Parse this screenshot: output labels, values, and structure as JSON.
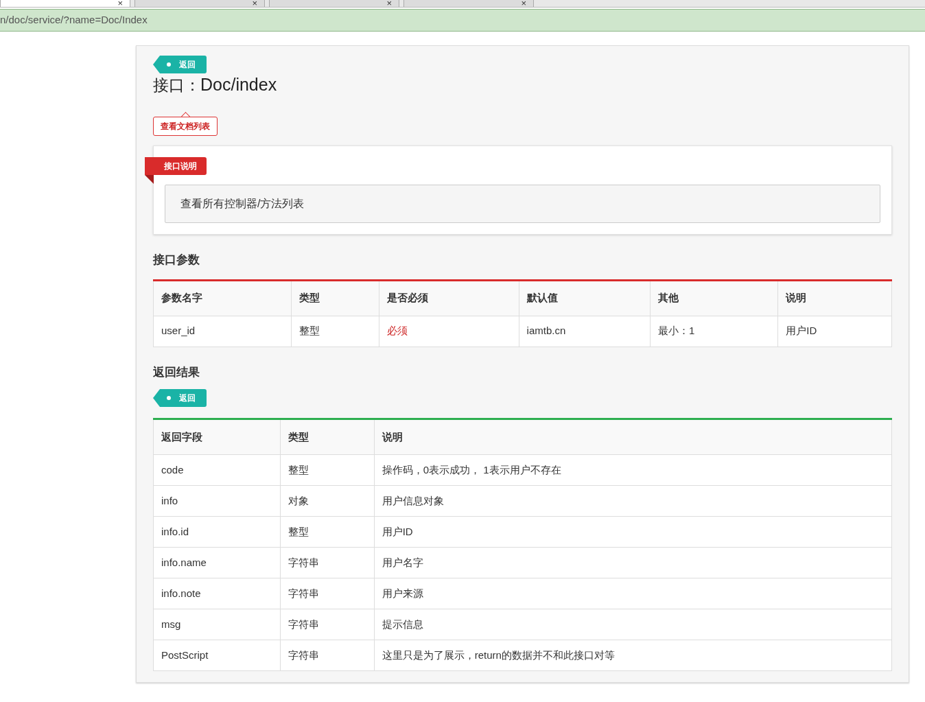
{
  "browser": {
    "tabs": [
      {
        "close": "×",
        "selected": true
      },
      {
        "close": "×",
        "selected": false
      },
      {
        "close": "×",
        "selected": false
      },
      {
        "close": "×",
        "selected": false
      }
    ],
    "address": "n/doc/service/?name=Doc/Index"
  },
  "back_tag": "返回",
  "title_prefix": "接口：",
  "title": "Doc/index",
  "doc_list_button": "查看文档列表",
  "description": {
    "ribbon": "接口说明",
    "text": "查看所有控制器/方法列表"
  },
  "params": {
    "heading": "接口参数",
    "columns": [
      "参数名字",
      "类型",
      "是否必须",
      "默认值",
      "其他",
      "说明"
    ],
    "rows": [
      {
        "cells": [
          "user_id",
          "整型",
          "必须",
          "iamtb.cn",
          "最小：1",
          "用户ID"
        ],
        "required": true
      }
    ]
  },
  "results": {
    "heading": "返回结果",
    "tag": "返回",
    "columns": [
      "返回字段",
      "类型",
      "说明"
    ],
    "rows": [
      [
        "code",
        "整型",
        "操作码，0表示成功， 1表示用户不存在"
      ],
      [
        "info",
        "对象",
        "用户信息对象"
      ],
      [
        "info.id",
        "整型",
        "用户ID"
      ],
      [
        "info.name",
        "字符串",
        "用户名字"
      ],
      [
        "info.note",
        "字符串",
        "用户来源"
      ],
      [
        "msg",
        "字符串",
        "提示信息"
      ],
      [
        "PostScript",
        "字符串",
        "这里只是为了展示，return的数据并不和此接口对等"
      ]
    ]
  }
}
